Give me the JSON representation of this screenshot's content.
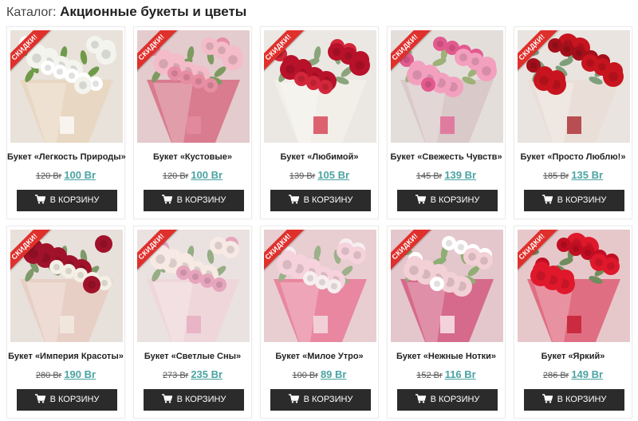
{
  "catalog": {
    "prefix": "Каталог:",
    "title": "Акционные букеты и цветы"
  },
  "badge_label": "СКИДКИ!",
  "button_label": "В КОРЗИНУ",
  "cart_icon": "cart-icon",
  "colors": {
    "price_accent": "#4ba3a3",
    "button_bg": "#2b2b2b",
    "ribbon": "#e0302c"
  },
  "products": [
    {
      "name": "Букет «Легкость Природы»",
      "old_price": "120 Br",
      "new_price": "100 Br",
      "palette": [
        "#f4f4ee",
        "#ffffff",
        "#6f9a4a",
        "#e8d7c2"
      ]
    },
    {
      "name": "Букет «Кустовые»",
      "old_price": "120 Br",
      "new_price": "100 Br",
      "palette": [
        "#f3bcc8",
        "#e78ea3",
        "#7d9a60",
        "#d97c8f"
      ]
    },
    {
      "name": "Букет «Любимой»",
      "old_price": "139 Br",
      "new_price": "105 Br",
      "palette": [
        "#b8122a",
        "#d3263a",
        "#8aa57c",
        "#f2efe9"
      ]
    },
    {
      "name": "Букет «Свежесть Чувств»",
      "old_price": "145 Br",
      "new_price": "139 Br",
      "palette": [
        "#f3a0bf",
        "#e25a8e",
        "#9db178",
        "#d9c9c9"
      ]
    },
    {
      "name": "Букет «Просто Люблю!»",
      "old_price": "185 Br",
      "new_price": "135 Br",
      "palette": [
        "#c8141f",
        "#a30f1a",
        "#7f9f7c",
        "#eadfd8"
      ]
    },
    {
      "name": "Букет «Империя Красоты»",
      "old_price": "280 Br",
      "new_price": "190 Br",
      "palette": [
        "#a0122a",
        "#f5f0e6",
        "#7f9a6a",
        "#e7cfc6"
      ]
    },
    {
      "name": "Букет «Светлые Сны»",
      "old_price": "273 Br",
      "new_price": "235 Br",
      "palette": [
        "#f7e9e4",
        "#e6a5bd",
        "#96ad86",
        "#efd6da"
      ]
    },
    {
      "name": "Букет «Милое Утро»",
      "old_price": "100 Br",
      "new_price": "89 Br",
      "palette": [
        "#f6d2dc",
        "#f7eef0",
        "#9cb08a",
        "#e8879f"
      ]
    },
    {
      "name": "Букет «Нежные Нотки»",
      "old_price": "152 Br",
      "new_price": "116 Br",
      "palette": [
        "#f2d0d5",
        "#ffffff",
        "#8fae74",
        "#d66a8c"
      ]
    },
    {
      "name": "Букет «Яркий»",
      "old_price": "286 Br",
      "new_price": "149 Br",
      "palette": [
        "#e0182c",
        "#c10e22",
        "#6f8d5e",
        "#e06e82"
      ]
    }
  ]
}
